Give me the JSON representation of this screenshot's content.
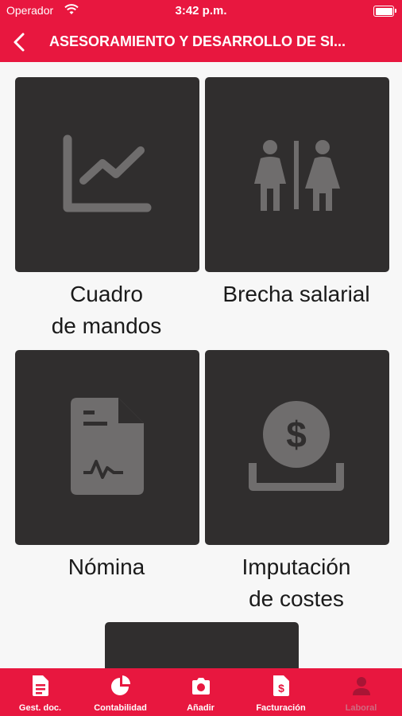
{
  "theme": {
    "accent": "#e8173f",
    "tile_bg": "#302e2e",
    "icon_color": "#6f6d6d"
  },
  "status_bar": {
    "carrier": "Operador",
    "time": "3:42 p.m."
  },
  "header": {
    "title": "ASESORAMIENTO Y DESARROLLO DE SI..."
  },
  "tiles": [
    {
      "icon": "line-chart-icon",
      "line1": "Cuadro",
      "line2": "de mandos"
    },
    {
      "icon": "restroom-icon",
      "line1": "Brecha salarial",
      "line2": ""
    },
    {
      "icon": "payroll-document-icon",
      "line1": "Nómina",
      "line2": ""
    },
    {
      "icon": "coin-dollar-icon",
      "line1": "Imputación",
      "line2": "de costes"
    }
  ],
  "tabs": [
    {
      "icon": "document-icon",
      "label": "Gest. doc."
    },
    {
      "icon": "pie-chart-icon",
      "label": "Contabilidad"
    },
    {
      "icon": "camera-icon",
      "label": "Añadir"
    },
    {
      "icon": "invoice-icon",
      "label": "Facturación"
    },
    {
      "icon": "person-icon",
      "label": "Laboral",
      "active": true
    }
  ]
}
